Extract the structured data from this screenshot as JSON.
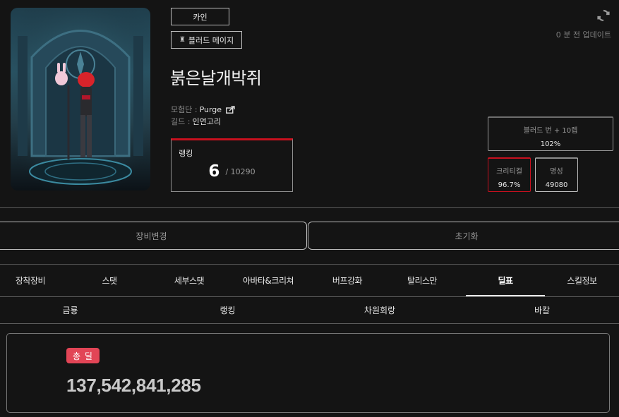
{
  "character": {
    "server_tag": "카인",
    "job_tag": "블러드 메이지",
    "name": "붉은날개박쥐",
    "adventure_label": "모험단 : ",
    "adventure_name": "Purge",
    "guild_label": "길드 : ",
    "guild_name": "인연고리"
  },
  "ranking": {
    "title": "랭킹",
    "value": "6",
    "total": "/ 10290"
  },
  "update": {
    "count": "0",
    "suffix": " 분 전 업데이트"
  },
  "stats": {
    "bloodburn": {
      "label": "블러드 번 + 10렙",
      "value": "102%"
    },
    "critical": {
      "label": "크리티컬",
      "value": "96.7%"
    },
    "fame": {
      "label": "명성",
      "value": "49080"
    }
  },
  "actions": {
    "equip_change": "장비변경",
    "reset": "초기화"
  },
  "main_tabs": [
    {
      "label": "장착장비"
    },
    {
      "label": "스탯"
    },
    {
      "label": "세부스탯"
    },
    {
      "label": "아바타&크리쳐"
    },
    {
      "label": "버프강화"
    },
    {
      "label": "탈리스만"
    },
    {
      "label": "딜표",
      "active": true
    },
    {
      "label": "스킬정보"
    }
  ],
  "sub_tabs": [
    {
      "label": "금룡"
    },
    {
      "label": "랭킹",
      "active": true
    },
    {
      "label": "차원회랑"
    },
    {
      "label": "바칼"
    }
  ],
  "result": {
    "badge": "총 딜",
    "value": "137,542,841,285"
  },
  "colors": {
    "background": "#141414",
    "accent_red": "#c8101e",
    "badge_pink": "#e24556",
    "sub_tab_underline": "#6f87b8"
  },
  "icons": {
    "refresh": "refresh-icon",
    "share": "share-icon",
    "job": "job-icon"
  }
}
